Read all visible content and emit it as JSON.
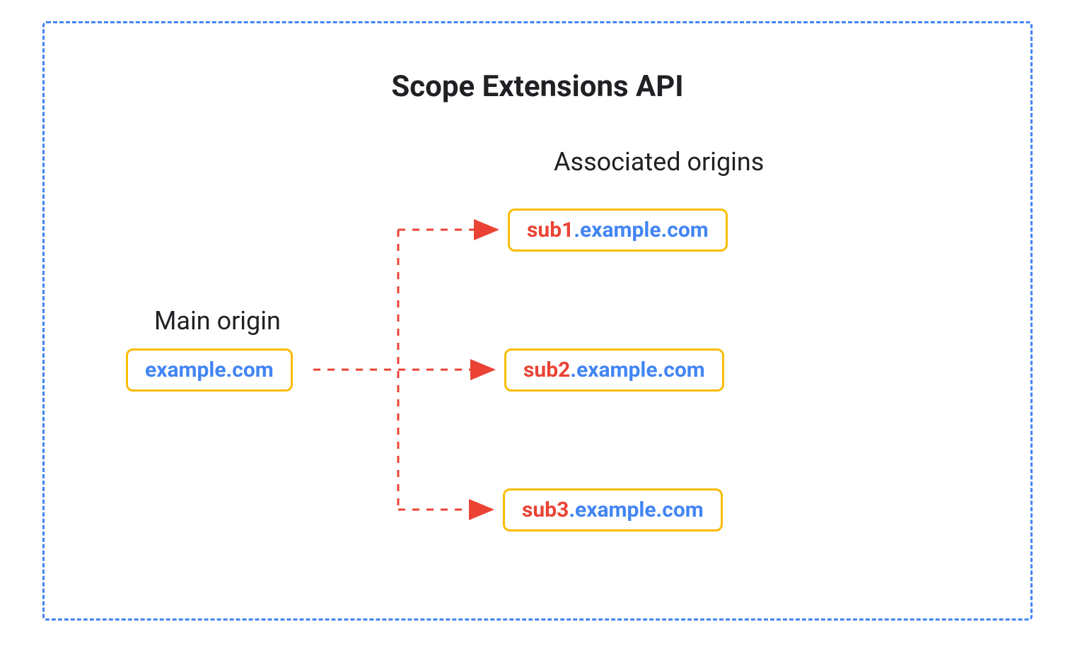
{
  "title": "Scope Extensions API",
  "mainOrigin": {
    "label": "Main origin",
    "domain": "example.com"
  },
  "associatedOrigins": {
    "label": "Associated origins",
    "items": [
      {
        "subdomain": "sub1",
        "domain": "example.com"
      },
      {
        "subdomain": "sub2",
        "domain": "example.com"
      },
      {
        "subdomain": "sub3",
        "domain": "example.com"
      }
    ]
  },
  "colors": {
    "border": "#4285f4",
    "boxBorder": "#fbbc04",
    "domain": "#4285f4",
    "subdomain": "#ea4335",
    "arrow": "#ea4335"
  }
}
